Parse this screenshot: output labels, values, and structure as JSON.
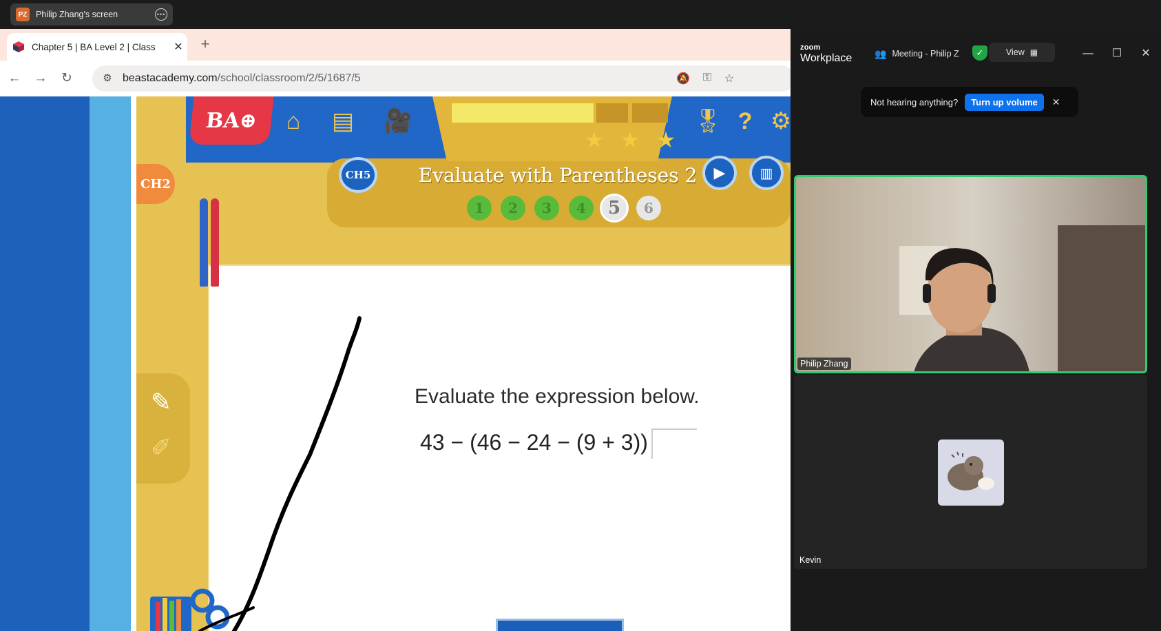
{
  "share_bar": {
    "badge": "PZ",
    "label": "Philip Zhang's screen"
  },
  "browser": {
    "tab_title": "Chapter 5 | BA Level 2 | Class",
    "url_host": "beastacademy.com",
    "url_path": "/school/classroom/2/5/1687/5"
  },
  "lesson": {
    "chapter_badge": "CH5",
    "prev_chapter_badge": "CH2",
    "title": "Evaluate with Parentheses 2",
    "questions": [
      {
        "label": "1",
        "state": "done"
      },
      {
        "label": "2",
        "state": "done"
      },
      {
        "label": "3",
        "state": "done"
      },
      {
        "label": "4",
        "state": "done"
      },
      {
        "label": "5",
        "state": "current"
      },
      {
        "label": "6",
        "state": "todo"
      }
    ],
    "progress_fraction": 0.66,
    "stars_total": 3,
    "prompt": "Evaluate the expression below.",
    "expression": "43 − (46 − 24 − (9 + 3)) =",
    "answer_value": ""
  },
  "zoom": {
    "brand_small": "zoom",
    "brand_big": "Workplace",
    "meeting_title": "Meeting - Philip Z",
    "view_label": "View",
    "notice_text": "Not hearing anything?",
    "notice_button": "Turn up volume",
    "participants": [
      {
        "name": "Philip Zhang",
        "video": true,
        "active_speaker": true
      },
      {
        "name": "Kevin",
        "video": false,
        "active_speaker": false
      }
    ]
  },
  "colors": {
    "accent_zoom": "#0e72ed",
    "active_speaker": "#2ecc71",
    "beast_blue": "#2167c8",
    "beast_gold": "#e6c253",
    "beast_red": "#e63747"
  }
}
